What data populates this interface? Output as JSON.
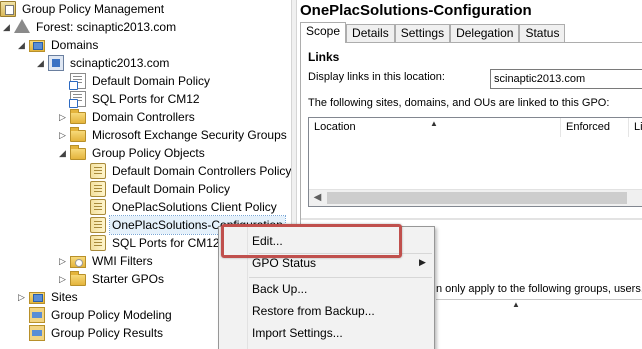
{
  "tree": {
    "root": "Group Policy Management",
    "forest": "Forest: scinaptic2013.com",
    "domains": "Domains",
    "domain": "scinaptic2013.com",
    "link_default_domain_policy": "Default Domain Policy",
    "link_sql_ports": "SQL Ports for CM12",
    "ou_domain_controllers": "Domain Controllers",
    "ou_exchange_security_groups": "Microsoft Exchange Security Groups",
    "group_policy_objects": "Group Policy Objects",
    "gpo_ddc_policy": "Default Domain Controllers Policy",
    "gpo_default_domain_policy": "Default Domain Policy",
    "gpo_client_policy": "OnePlacSolutions Client Policy",
    "gpo_configuration": "OnePlacSolutions-Configuration",
    "gpo_sql_ports": "SQL Ports for CM12",
    "wmi_filters": "WMI Filters",
    "starter_gpos": "Starter GPOs",
    "sites": "Sites",
    "gp_modeling": "Group Policy Modeling",
    "gp_results": "Group Policy Results"
  },
  "details": {
    "title": "OnePlacSolutions-Configuration",
    "tabs": [
      "Scope",
      "Details",
      "Settings",
      "Delegation",
      "Status"
    ],
    "active_tab": "Scope",
    "links_heading": "Links",
    "display_links_label": "Display links in this location:",
    "display_links_value": "scinaptic2013.com",
    "linked_label": "The following sites, domains, and OUs are linked to this GPO:",
    "columns": [
      "Location",
      "Enforced",
      "Li"
    ],
    "filtering_text": "n only apply to the following groups, users, a"
  },
  "context_menu": {
    "items": [
      "Edit...",
      "GPO Status",
      "Back Up...",
      "Restore from Backup...",
      "Import Settings..."
    ]
  },
  "colors": {
    "highlight_border": "#c0504d",
    "selection_bg": "#e5f1fb"
  }
}
